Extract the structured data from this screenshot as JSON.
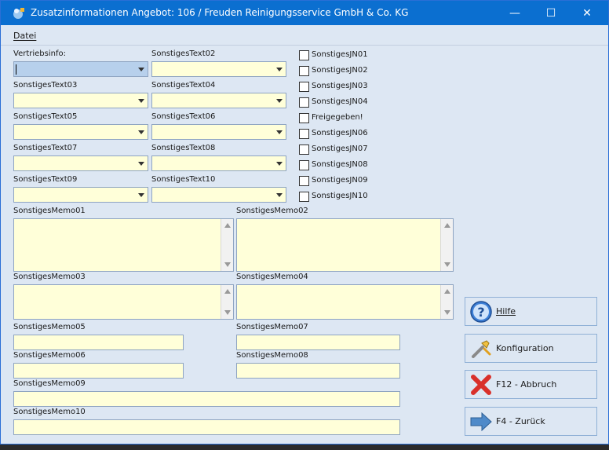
{
  "window": {
    "title": "Zusatzinformationen Angebot: 106 / Freuden Reinigungsservice GmbH & Co. KG",
    "controls": {
      "minimize": "—",
      "maximize": "☐",
      "close": "✕"
    }
  },
  "menu": {
    "items": [
      {
        "label": "Datei"
      }
    ]
  },
  "combos": [
    {
      "label": "Vertriebsinfo:",
      "value": ""
    },
    {
      "label": "SonstigesText02",
      "value": ""
    },
    {
      "label": "SonstigesText03",
      "value": ""
    },
    {
      "label": "SonstigesText04",
      "value": ""
    },
    {
      "label": "SonstigesText05",
      "value": ""
    },
    {
      "label": "SonstigesText06",
      "value": ""
    },
    {
      "label": "SonstigesText07",
      "value": ""
    },
    {
      "label": "SonstigesText08",
      "value": ""
    },
    {
      "label": "SonstigesText09",
      "value": ""
    },
    {
      "label": "SonstigesText10",
      "value": ""
    }
  ],
  "checkboxes": [
    {
      "label": "SonstigesJN01",
      "checked": false
    },
    {
      "label": "SonstigesJN02",
      "checked": false
    },
    {
      "label": "SonstigesJN03",
      "checked": false
    },
    {
      "label": "SonstigesJN04",
      "checked": false
    },
    {
      "label": "Freigegeben!",
      "checked": false
    },
    {
      "label": "SonstigesJN06",
      "checked": false
    },
    {
      "label": "SonstigesJN07",
      "checked": false
    },
    {
      "label": "SonstigesJN08",
      "checked": false
    },
    {
      "label": "SonstigesJN09",
      "checked": false
    },
    {
      "label": "SonstigesJN10",
      "checked": false
    }
  ],
  "memos": [
    {
      "label": "SonstigesMemo01",
      "value": ""
    },
    {
      "label": "SonstigesMemo02",
      "value": ""
    },
    {
      "label": "SonstigesMemo03",
      "value": ""
    },
    {
      "label": "SonstigesMemo04",
      "value": ""
    }
  ],
  "fields": [
    {
      "label": "SonstigesMemo05",
      "value": ""
    },
    {
      "label": "SonstigesMemo07",
      "value": ""
    },
    {
      "label": "SonstigesMemo06",
      "value": ""
    },
    {
      "label": "SonstigesMemo08",
      "value": ""
    },
    {
      "label": "SonstigesMemo09",
      "value": ""
    },
    {
      "label": "SonstigesMemo10",
      "value": ""
    }
  ],
  "buttons": {
    "help": {
      "label": "Hilfe",
      "icon": "help-icon"
    },
    "config": {
      "label": "Konfiguration",
      "icon": "wrench-icon"
    },
    "cancel": {
      "label": "F12 - Abbruch",
      "icon": "red-x-icon"
    },
    "back": {
      "label": "F4 - Zurück",
      "icon": "arrow-right-icon"
    }
  },
  "colors": {
    "titlebar": "#0b6fd0",
    "field_bg": "#ffffd9",
    "focus_bg": "#b7d0ec",
    "window_bg": "#dde7f3"
  }
}
